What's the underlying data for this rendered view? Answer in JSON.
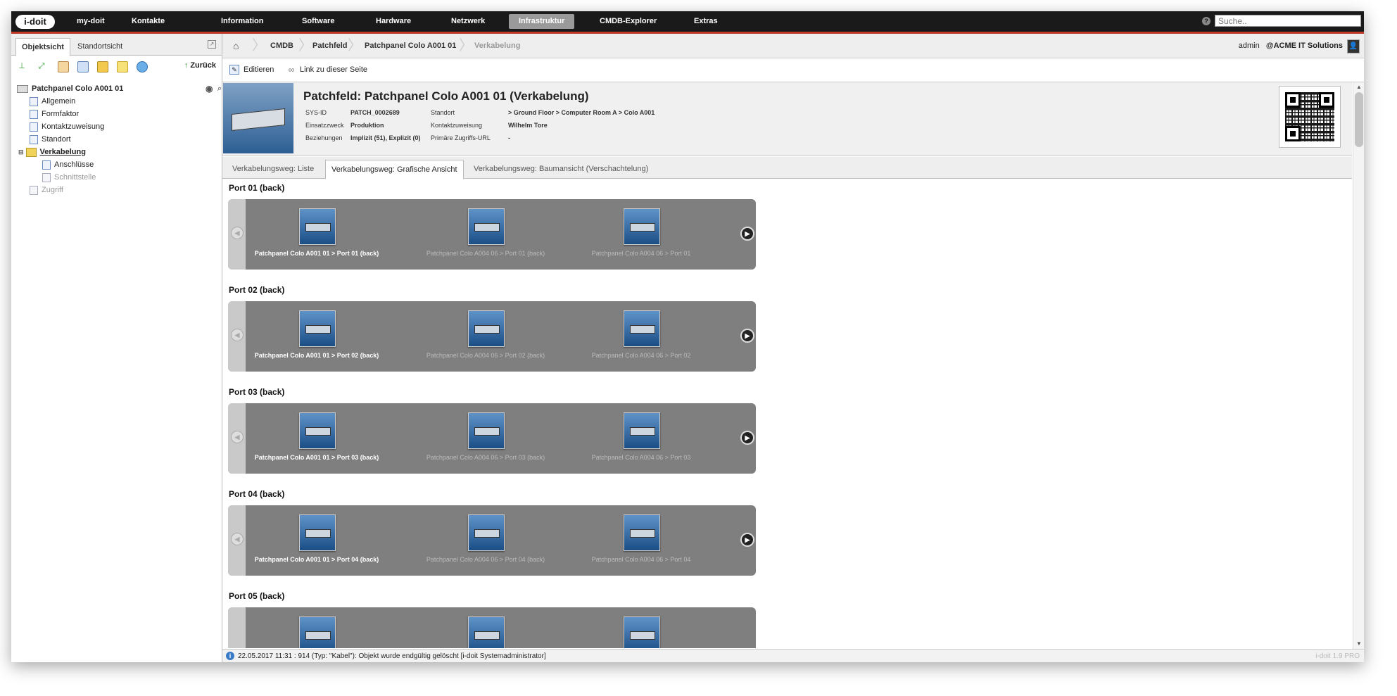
{
  "topnav": {
    "logo": "i-doit",
    "items": [
      "my-doit",
      "Kontakte",
      "Information",
      "Software",
      "Hardware",
      "Netzwerk",
      "Infrastruktur",
      "CMDB-Explorer",
      "Extras"
    ],
    "active_index": 6,
    "search_placeholder": "Suche.."
  },
  "left": {
    "tabs": [
      "Objektsicht",
      "Standortsicht"
    ],
    "back_label": "Zurück",
    "tree": {
      "root": "Patchpanel Colo A001 01",
      "items": [
        {
          "label": "Allgemein",
          "level": 1,
          "state": "normal"
        },
        {
          "label": "Formfaktor",
          "level": 1,
          "state": "normal"
        },
        {
          "label": "Kontaktzuweisung",
          "level": 1,
          "state": "normal"
        },
        {
          "label": "Standort",
          "level": 1,
          "state": "normal"
        },
        {
          "label": "Verkabelung",
          "level": 1,
          "state": "selected"
        },
        {
          "label": "Anschlüsse",
          "level": 2,
          "state": "normal"
        },
        {
          "label": "Schnittstelle",
          "level": 2,
          "state": "muted"
        },
        {
          "label": "Zugriff",
          "level": 1,
          "state": "muted"
        }
      ]
    }
  },
  "breadcrumb": {
    "items": [
      "CMDB",
      "Patchfeld",
      "Patchpanel Colo A001 01"
    ],
    "current": "Verkabelung"
  },
  "user": {
    "name": "admin",
    "org": "@ACME IT Solutions"
  },
  "actions": {
    "edit": "Editieren",
    "link": "Link zu dieser Seite"
  },
  "object": {
    "title": "Patchfeld: Patchpanel Colo A001 01 (Verkabelung)",
    "sysid_label": "SYS-ID",
    "sysid": "PATCH_0002689",
    "purpose_label": "Einsatzzweck",
    "purpose": "Produktion",
    "relations_label": "Beziehungen",
    "relations": "Implizit (51), Explizit (0)",
    "location_label": "Standort",
    "location": "> Ground Floor > Computer Room A > Colo A001",
    "contact_label": "Kontaktzuweisung",
    "contact": "Wilhelm Tore",
    "url_label": "Primäre Zugriffs-URL",
    "url": "-"
  },
  "tabs": [
    "Verkabelungsweg: Liste",
    "Verkabelungsweg: Grafische Ansicht",
    "Verkabelungsweg: Baumansicht (Verschachtelung)"
  ],
  "active_tab": 1,
  "ports": [
    {
      "title": "Port 01 (back)",
      "captions": [
        "Patchpanel Colo A001 01 > Port 01 (back)",
        "Patchpanel Colo A004 06 > Port 01 (back)",
        "Patchpanel Colo A004 06 > Port 01"
      ]
    },
    {
      "title": "Port 02 (back)",
      "captions": [
        "Patchpanel Colo A001 01 > Port 02 (back)",
        "Patchpanel Colo A004 06 > Port 02 (back)",
        "Patchpanel Colo A004 06 > Port 02"
      ]
    },
    {
      "title": "Port 03 (back)",
      "captions": [
        "Patchpanel Colo A001 01 > Port 03 (back)",
        "Patchpanel Colo A004 06 > Port 03 (back)",
        "Patchpanel Colo A004 06 > Port 03"
      ]
    },
    {
      "title": "Port 04 (back)",
      "captions": [
        "Patchpanel Colo A001 01 > Port 04 (back)",
        "Patchpanel Colo A004 06 > Port 04 (back)",
        "Patchpanel Colo A004 06 > Port 04"
      ]
    },
    {
      "title": "Port 05 (back)",
      "captions": [
        "",
        "",
        ""
      ]
    }
  ],
  "status": {
    "message": "22.05.2017 11:31 : 914 (Typ: \"Kabel\"): Objekt wurde endgültig gelöscht [i-doit Systemadministrator]",
    "version": "i-doit 1.9 PRO"
  }
}
